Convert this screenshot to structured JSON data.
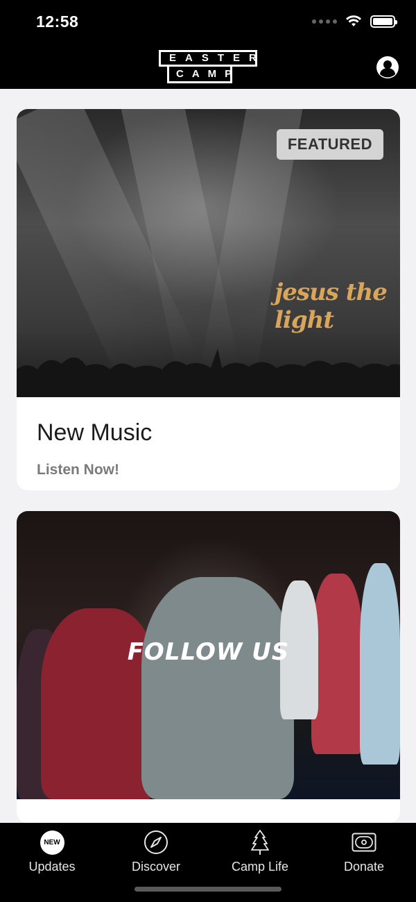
{
  "status_bar": {
    "time": "12:58"
  },
  "header": {
    "logo_line1": "EASTER",
    "logo_line2": "CAMP"
  },
  "feed": {
    "cards": [
      {
        "badge": "FEATURED",
        "image_text": "jesus the light",
        "title": "New Music",
        "subtitle": "Listen Now!"
      },
      {
        "image_text": "FOLLOW US"
      }
    ]
  },
  "tab_bar": {
    "tabs": [
      {
        "label": "Updates",
        "badge": "NEW",
        "icon": "new-badge-icon",
        "active": true
      },
      {
        "label": "Discover",
        "icon": "compass-icon"
      },
      {
        "label": "Camp Life",
        "icon": "tree-icon"
      },
      {
        "label": "Donate",
        "icon": "money-icon"
      }
    ]
  },
  "colors": {
    "background": "#f2f2f5",
    "bar": "#000000",
    "accent_gold": "#d8a55a"
  }
}
